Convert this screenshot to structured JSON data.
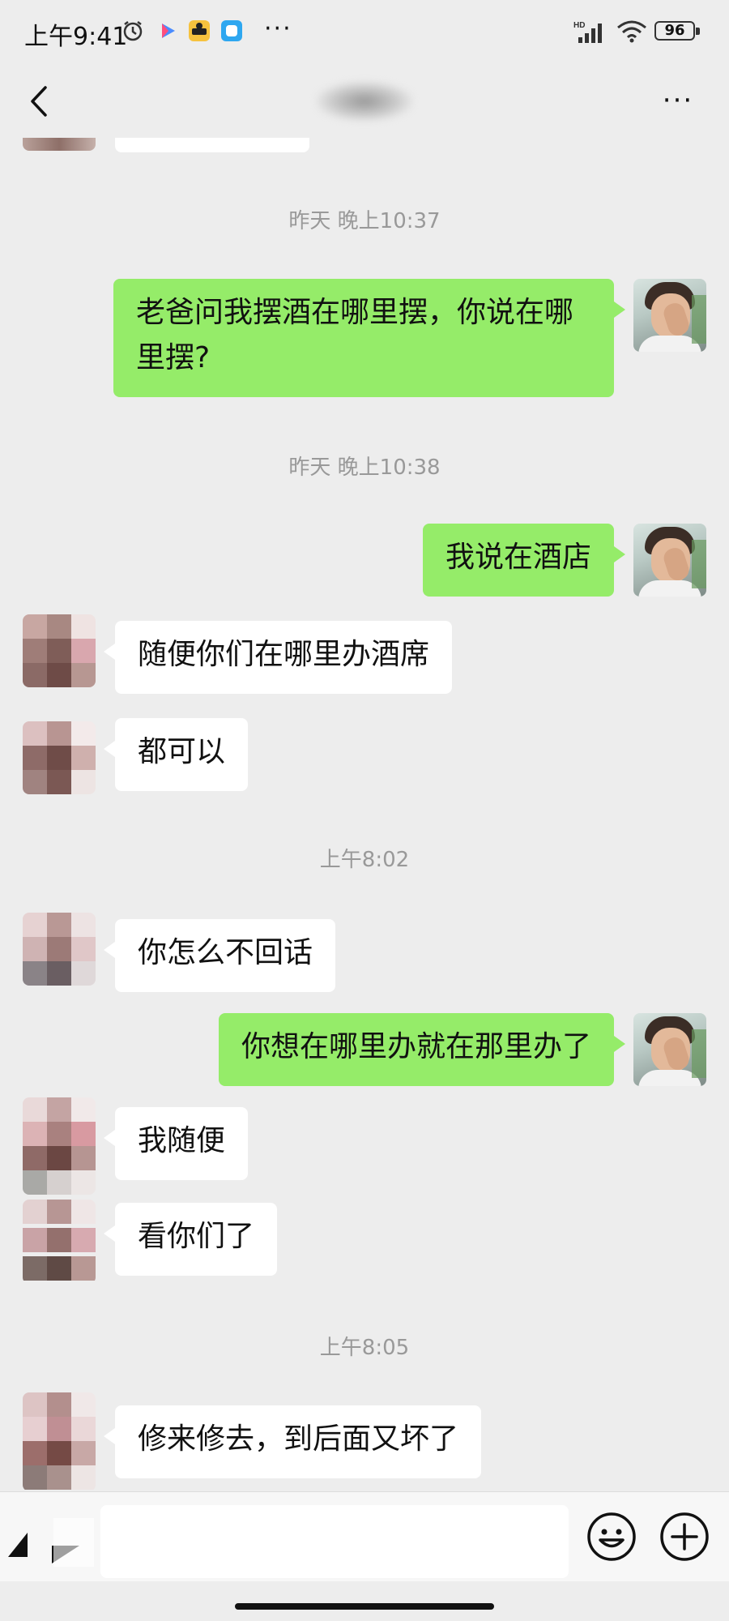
{
  "status_bar": {
    "time": "上午9:41",
    "signal_label": "HD",
    "battery": "96",
    "more": "···"
  },
  "nav": {
    "more": "···"
  },
  "messages": [
    {
      "type": "timestamp",
      "text": "昨天 晚上10:37"
    },
    {
      "type": "msg",
      "from": "me",
      "text": "老爸问我摆酒在哪里摆，你说在哪里摆?"
    },
    {
      "type": "timestamp",
      "text": "昨天 晚上10:38"
    },
    {
      "type": "msg",
      "from": "me",
      "text": "我说在酒店"
    },
    {
      "type": "msg",
      "from": "them",
      "text": "随便你们在哪里办酒席"
    },
    {
      "type": "msg",
      "from": "them",
      "text": "都可以"
    },
    {
      "type": "timestamp",
      "text": "上午8:02"
    },
    {
      "type": "msg",
      "from": "them",
      "text": "你怎么不回话"
    },
    {
      "type": "msg",
      "from": "me",
      "text": "你想在哪里办就在那里办了"
    },
    {
      "type": "msg",
      "from": "them",
      "text": "我随便"
    },
    {
      "type": "msg",
      "from": "them",
      "text": "看你们了"
    },
    {
      "type": "timestamp",
      "text": "上午8:05"
    },
    {
      "type": "msg",
      "from": "them",
      "text": "修来修去，到后面又坏了"
    }
  ],
  "input": {
    "value": "",
    "placeholder": ""
  },
  "icons": {
    "back": "chevron-left-icon",
    "more": "more-dots-icon",
    "voice": "voice-toggle-icon",
    "emoji": "emoji-icon",
    "plus": "plus-circle-icon"
  },
  "colors": {
    "background": "#ededed",
    "my_bubble": "#95ec69",
    "their_bubble": "#ffffff",
    "timestamp": "#999999"
  }
}
